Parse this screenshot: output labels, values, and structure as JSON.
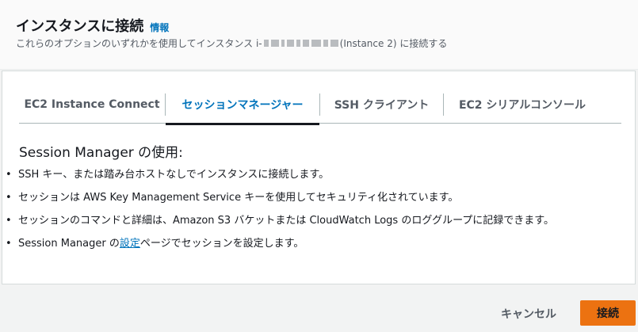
{
  "header": {
    "title": "インスタンスに接続",
    "info_link": "情報",
    "subtitle_prefix": "これらのオプションのいずれかを使用してインスタンス i-",
    "subtitle_suffix": "(Instance 2) に接続する"
  },
  "tabs": [
    {
      "label": "EC2 Instance Connect",
      "active": false
    },
    {
      "label": "セッションマネージャー",
      "active": true
    },
    {
      "label": "SSH クライアント",
      "active": false
    },
    {
      "label": "EC2 シリアルコンソール",
      "active": false
    }
  ],
  "content": {
    "section_title": "Session Manager の使用:",
    "bullets": [
      "SSH キー、または踏み台ホストなしでインスタンスに接続します。",
      "セッションは AWS Key Management Service キーを使用してセキュリティ化されています。",
      "セッションのコマンドと詳細は、Amazon S3 バケットまたは CloudWatch Logs のロググループに記録できます。"
    ],
    "last_bullet_prefix": "Session Manager の",
    "last_bullet_link": "設定",
    "last_bullet_suffix": "ページでセッションを設定します。"
  },
  "footer": {
    "cancel_label": "キャンセル",
    "connect_label": "接続"
  },
  "colors": {
    "accent_link": "#0073bb",
    "primary_button": "#ec7211",
    "text": "#16191f"
  }
}
